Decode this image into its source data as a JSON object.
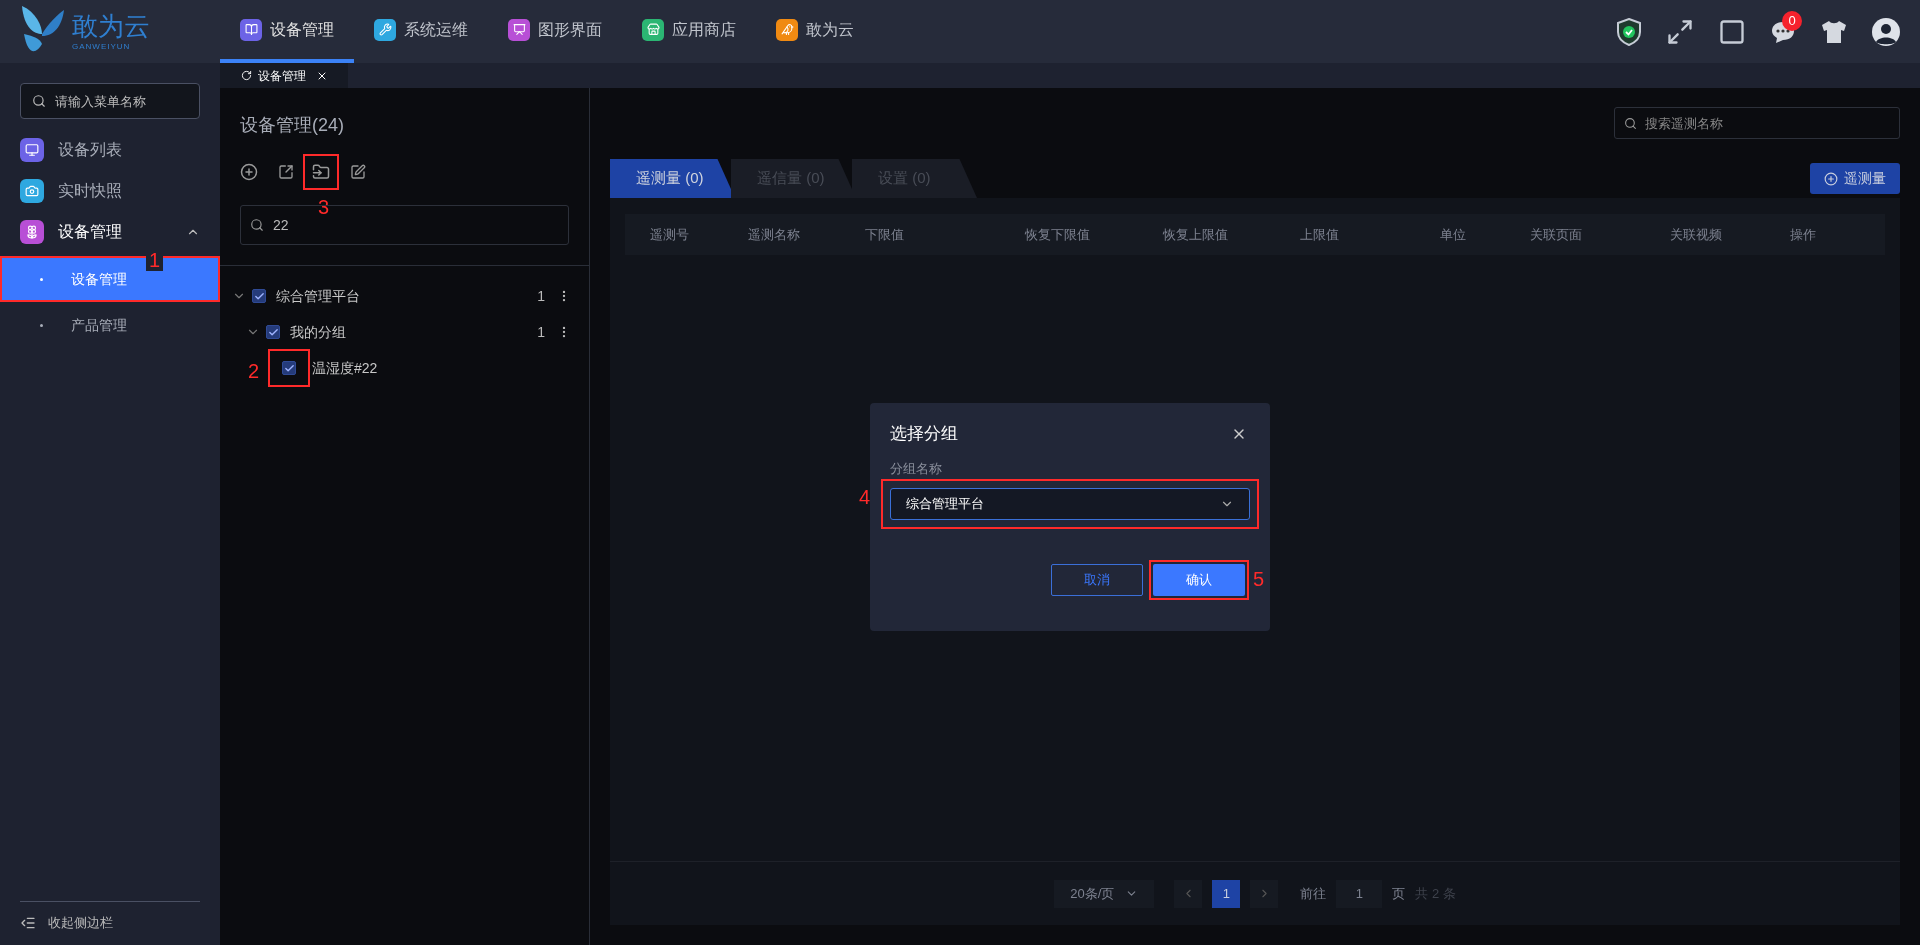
{
  "logo": {
    "name": "敢为云",
    "subtitle": "GANWEIYUN"
  },
  "top_nav": [
    {
      "label": "设备管理",
      "selected": true,
      "color": "#6c63e6"
    },
    {
      "label": "系统运维",
      "selected": false,
      "color": "#2ea8e0"
    },
    {
      "label": "图形界面",
      "selected": false,
      "color": "#b84fd6"
    },
    {
      "label": "应用商店",
      "selected": false,
      "color": "#2bb673"
    },
    {
      "label": "敢为云",
      "selected": false,
      "color": "#f08a12"
    }
  ],
  "notifications": {
    "count": "0"
  },
  "sidebar": {
    "search_placeholder": "请输入菜单名称",
    "items": [
      {
        "label": "设备列表",
        "color": "#6c63e6"
      },
      {
        "label": "实时快照",
        "color": "#2ea8e0"
      },
      {
        "label": "设备管理",
        "color": "#b84fd6",
        "expanded": true,
        "children": [
          {
            "label": "设备管理",
            "selected": true,
            "annotation": "1"
          },
          {
            "label": "产品管理",
            "selected": false
          }
        ]
      }
    ],
    "collapse": "收起侧边栏"
  },
  "page_tabs": [
    {
      "label": "设备管理",
      "selected": true
    }
  ],
  "device_panel": {
    "title": "设备管理(24)",
    "move_annotation": "3",
    "search_value": "22",
    "tree": [
      {
        "label": "综合管理平台",
        "checked": true,
        "expanded": true,
        "count": "1",
        "children": [
          {
            "label": "我的分组",
            "checked": true,
            "expanded": true,
            "count": "1",
            "children": [
              {
                "label": "温湿度#22",
                "checked": true,
                "annotation": "2"
              }
            ]
          }
        ]
      }
    ]
  },
  "search_placeholder": "搜索遥测名称",
  "tabs": [
    {
      "label": "遥测量 (0)",
      "selected": true
    },
    {
      "label": "遥信量 (0)",
      "selected": false
    },
    {
      "label": "设置 (0)",
      "selected": false
    }
  ],
  "add_button": "遥测量",
  "table": {
    "columns": [
      "遥测号",
      "遥测名称",
      "下限值",
      "恢复下限值",
      "恢复上限值",
      "上限值",
      "单位",
      "关联页面",
      "关联视频",
      "操作"
    ]
  },
  "pagination": {
    "page_size": "20条/页",
    "pages": [
      {
        "label": "1",
        "selected": true
      }
    ],
    "goto_label": "前往",
    "goto_value": "1",
    "page_unit": "页",
    "total": "共 2 条"
  },
  "dialog": {
    "title": "选择分组",
    "field_label": "分组名称",
    "value": "综合管理平台",
    "field_annotation": "4",
    "buttons": [
      {
        "label": "取消",
        "kind": "secondary"
      },
      {
        "label": "确认",
        "kind": "primary",
        "annotation": "5"
      }
    ]
  }
}
